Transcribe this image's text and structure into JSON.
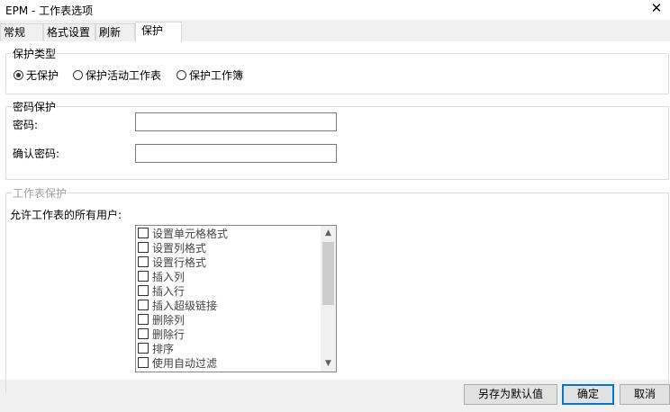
{
  "window": {
    "title": "EPM - 工作表选项",
    "close_glyph": "✕"
  },
  "tabs": [
    {
      "label": "常规",
      "active": false
    },
    {
      "label": "格式设置",
      "active": false
    },
    {
      "label": "刷新",
      "active": false
    },
    {
      "label": "保护",
      "active": true
    }
  ],
  "protection_type": {
    "legend": "保护类型",
    "options": [
      {
        "label": "无保护",
        "checked": true
      },
      {
        "label": "保护活动工作表",
        "checked": false
      },
      {
        "label": "保护工作簿",
        "checked": false
      }
    ]
  },
  "password_protection": {
    "legend": "密码保护",
    "password_label": "密码:",
    "password_value": "",
    "confirm_label": "确认密码:",
    "confirm_value": ""
  },
  "sheet_protection": {
    "legend": "工作表保护",
    "allow_label": "允许工作表的所有用户:",
    "items": [
      {
        "label": "设置单元格格式",
        "checked": false
      },
      {
        "label": "设置列格式",
        "checked": false
      },
      {
        "label": "设置行格式",
        "checked": false
      },
      {
        "label": "插入列",
        "checked": false
      },
      {
        "label": "插入行",
        "checked": false
      },
      {
        "label": "插入超级链接",
        "checked": false
      },
      {
        "label": "删除列",
        "checked": false
      },
      {
        "label": "删除行",
        "checked": false
      },
      {
        "label": "排序",
        "checked": false
      },
      {
        "label": "使用自动过滤",
        "checked": false
      }
    ]
  },
  "buttons": {
    "save_default": "另存为默认值",
    "ok": "确定",
    "cancel": "取消"
  },
  "icons": {
    "scroll_up": "▲",
    "scroll_down": "▼"
  },
  "colors": {
    "accent": "#0078d7",
    "disabled_text": "#a0a0a0"
  }
}
